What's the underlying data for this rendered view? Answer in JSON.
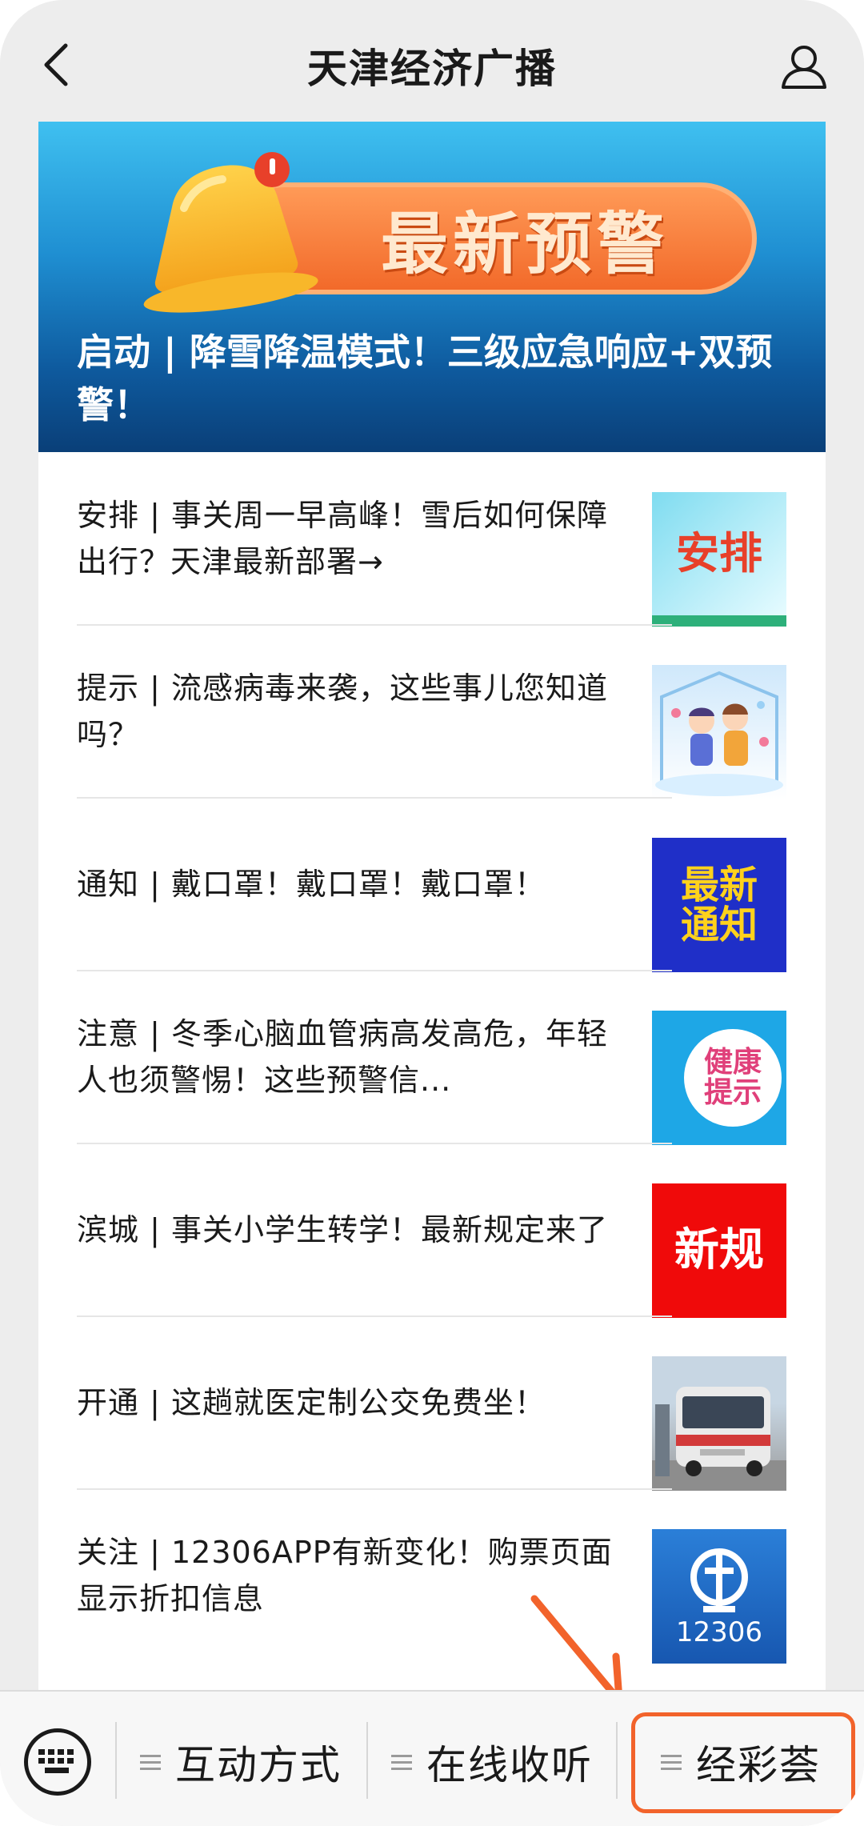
{
  "nav": {
    "title": "天津经济广播"
  },
  "banner": {
    "badge_text": "最新预警",
    "headline": "启动 | 降雪降温模式！三级应急响应+双预警！"
  },
  "articles": [
    {
      "title": "安排 | 事关周一早高峰！雪后如何保障出行？天津最新部署→",
      "thumb_text": "安排"
    },
    {
      "title": "提示 | 流感病毒来袭，这些事儿您知道吗？",
      "thumb_text": ""
    },
    {
      "title": "通知 | 戴口罩！戴口罩！戴口罩！",
      "thumb_text": "最新通知"
    },
    {
      "title": "注意 | 冬季心脑血管病高发高危，年轻人也须警惕！这些预警信...",
      "thumb_text": "健康提示"
    },
    {
      "title": "滨城 | 事关小学生转学！最新规定来了",
      "thumb_text": "新规"
    },
    {
      "title": "开通 | 这趟就医定制公交免费坐！",
      "thumb_text": ""
    },
    {
      "title": "关注 | 12306APP有新变化！购票页面显示折扣信息",
      "thumb_text": "12306"
    }
  ],
  "bottom_menu": {
    "items": [
      "互动方式",
      "在线收听",
      "经彩荟"
    ]
  },
  "colors": {
    "accent": "#f2632b",
    "banner_top": "#3fc0f0",
    "banner_bottom": "#0a3f78"
  }
}
